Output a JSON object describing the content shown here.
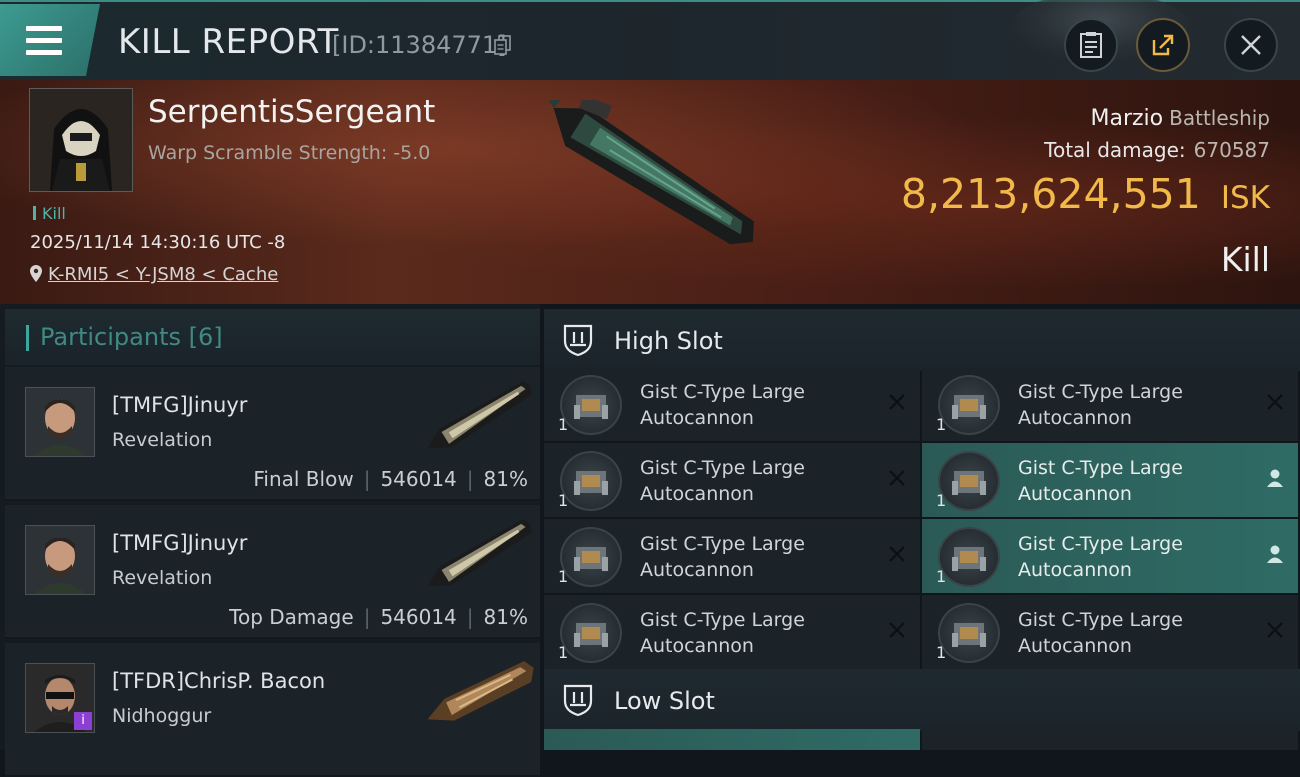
{
  "header": {
    "title": "KILL REPORT",
    "report_id": "[ID:11384771]"
  },
  "victim": {
    "name": "SerpentisSergeant",
    "subtitle": "Warp Scramble Strength: -5.0",
    "tag": "Kill",
    "timestamp": "2025/11/14 14:30:16 UTC -8",
    "location": "K-RMI5 < Y-JSM8 < Cache",
    "ship_name": "Marzio",
    "ship_class": "Battleship",
    "total_damage_label": "Total damage:",
    "total_damage": "670587",
    "isk_value": "8,213,624,551",
    "isk_unit": "ISK",
    "result": "Kill"
  },
  "participants": {
    "label": "Participants",
    "count": "[6]",
    "rows": [
      {
        "name": "[TMFG]Jinuyr",
        "ship": "Revelation",
        "role": "Final Blow",
        "damage": "546014",
        "percent": "81%"
      },
      {
        "name": "[TMFG]Jinuyr",
        "ship": "Revelation",
        "role": "Top Damage",
        "damage": "546014",
        "percent": "81%"
      },
      {
        "name": "[TFDR]ChrisP. Bacon",
        "ship": "Nidhoggur",
        "role": "",
        "damage": "",
        "percent": "",
        "badge": "i"
      }
    ]
  },
  "high_slot": {
    "label": "High Slot",
    "modules": [
      {
        "name": "Gist C-Type Large Autocannon",
        "qty": "1",
        "state": "destroyed"
      },
      {
        "name": "Gist C-Type Large Autocannon",
        "qty": "1",
        "state": "destroyed"
      },
      {
        "name": "Gist C-Type Large Autocannon",
        "qty": "1",
        "state": "destroyed"
      },
      {
        "name": "Gist C-Type Large Autocannon",
        "qty": "1",
        "state": "dropped"
      },
      {
        "name": "Gist C-Type Large Autocannon",
        "qty": "1",
        "state": "destroyed"
      },
      {
        "name": "Gist C-Type Large Autocannon",
        "qty": "1",
        "state": "dropped"
      },
      {
        "name": "Gist C-Type Large Autocannon",
        "qty": "1",
        "state": "destroyed"
      },
      {
        "name": "Gist C-Type Large Autocannon",
        "qty": "1",
        "state": "destroyed"
      }
    ]
  },
  "low_slot": {
    "label": "Low Slot"
  },
  "colors": {
    "accent": "#3d9b91",
    "isk": "#f1b94a",
    "dropped_bg": "#2f6b65"
  }
}
